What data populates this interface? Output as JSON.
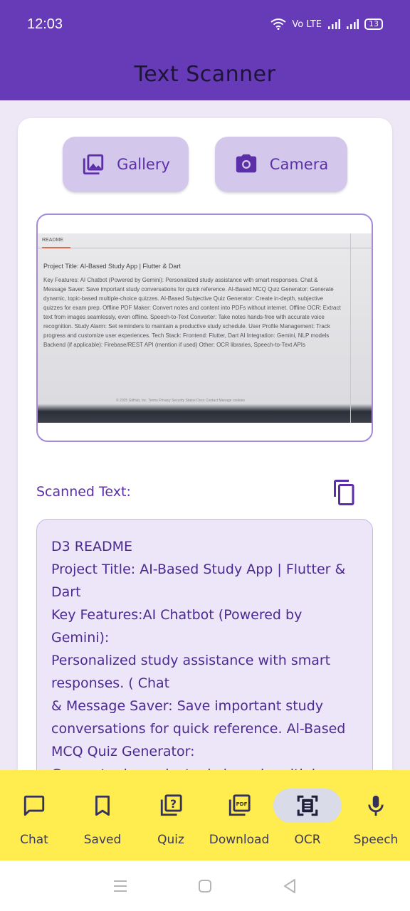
{
  "status_bar": {
    "time": "12:03",
    "network": "Vo LTE",
    "battery": "13"
  },
  "app_bar": {
    "title": "Text Scanner"
  },
  "buttons": {
    "gallery": {
      "label": "Gallery",
      "icon": "image-icon"
    },
    "camera": {
      "label": "Camera",
      "icon": "camera-icon"
    }
  },
  "preview": {
    "header": "README",
    "title_line": "Project Title: AI-Based Study App | Flutter & Dart",
    "body": "Key Features: AI Chatbot (Powered by Gemini): Personalized study assistance with smart responses. Chat & Message Saver: Save important study conversations for quick reference. AI-Based MCQ Quiz Generator: Generate dynamic, topic-based multiple-choice quizzes. AI-Based Subjective Quiz Generator: Create in-depth, subjective quizzes for exam prep. Offline PDF Maker: Convert notes and content into PDFs without internet. Offline OCR: Extract text from images seamlessly, even offline. Speech-to-Text Converter: Take notes hands-free with accurate voice recognition. Study Alarm: Set reminders to maintain a productive study schedule. User Profile Management: Track progress and customize user experiences. Tech Stack: Frontend: Flutter, Dart AI Integration: Gemini, NLP models Backend (if applicable): Firebase/REST API (mention if used) Other: OCR libraries, Speech-to-Text APIs",
    "footer": "© 2025 GitHub, Inc.  Terms  Privacy  Security  Status  Docs  Contact  Manage cookies"
  },
  "scanned": {
    "label": "Scanned Text:",
    "text": "D3 README\nProject Title: AI-Based Study App | Flutter &\nDart\nKey Features:AI Chatbot (Powered by Gemini):\nPersonalized study assistance with smart\nresponses. ( Chat\n& Message Saver: Save important study\nconversations for quick reference. Al-Based\nMCQ Quiz Generator:\nGenerate dynamic, topic-based multiple-\nchoice quizzes. AI-Based Subjective Quiz"
  },
  "nav": [
    {
      "label": "Chat",
      "icon": "chat-icon"
    },
    {
      "label": "Saved",
      "icon": "bookmark-icon"
    },
    {
      "label": "Quiz",
      "icon": "quiz-icon"
    },
    {
      "label": "Download",
      "icon": "pdf-icon"
    },
    {
      "label": "OCR",
      "icon": "document-scanner-icon",
      "active": true
    },
    {
      "label": "Speech",
      "icon": "mic-icon"
    }
  ],
  "colors": {
    "primary": "#673ab7",
    "button_bg": "#d4c7ec",
    "nav_bg": "#ffec4f",
    "text_box_bg": "#ede6f8"
  }
}
